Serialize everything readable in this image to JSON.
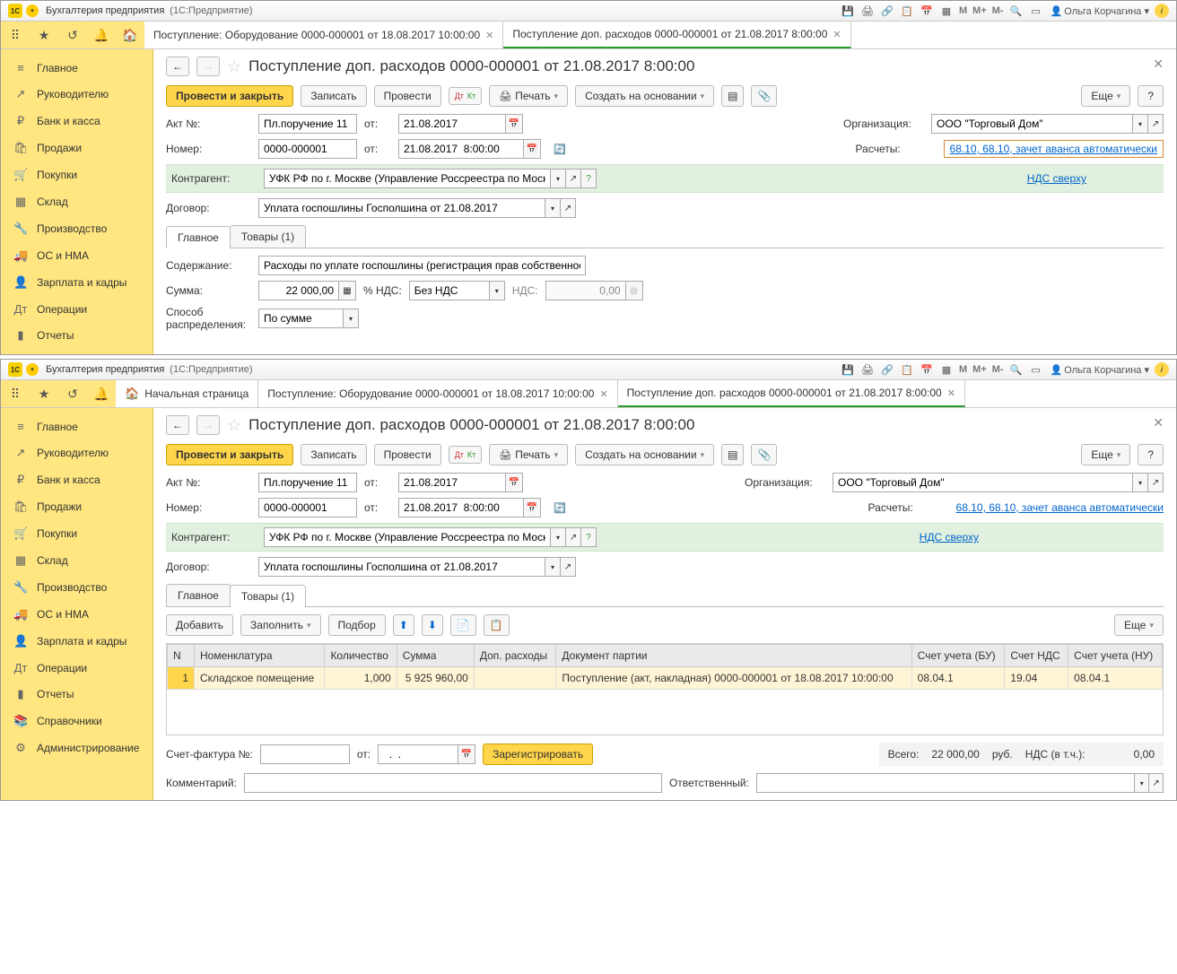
{
  "app": {
    "title": "Бухгалтерия предприятия",
    "subtitle": "(1С:Предприятие)",
    "user": "Ольга Корчагина",
    "marks": {
      "m": "M",
      "mp": "M+",
      "mm": "M-"
    }
  },
  "sidebar": {
    "items": [
      {
        "icon": "≡",
        "label": "Главное"
      },
      {
        "icon": "↗",
        "label": "Руководителю"
      },
      {
        "icon": "₽",
        "label": "Банк и касса"
      },
      {
        "icon": "🛍",
        "label": "Продажи"
      },
      {
        "icon": "🛒",
        "label": "Покупки"
      },
      {
        "icon": "▦",
        "label": "Склад"
      },
      {
        "icon": "🔧",
        "label": "Производство"
      },
      {
        "icon": "🚚",
        "label": "ОС и НМА"
      },
      {
        "icon": "👤",
        "label": "Зарплата и кадры"
      },
      {
        "icon": "Дт",
        "label": "Операции"
      },
      {
        "icon": "▮",
        "label": "Отчеты"
      },
      {
        "icon": "📚",
        "label": "Справочники"
      },
      {
        "icon": "⚙",
        "label": "Администрирование"
      }
    ]
  },
  "tabs": {
    "home_page": "Начальная страница",
    "t1": "Поступление: Оборудование 0000-000001 от 18.08.2017 10:00:00",
    "t2": "Поступление доп. расходов 0000-000001 от 21.08.2017 8:00:00"
  },
  "page": {
    "title": "Поступление доп. расходов 0000-000001 от 21.08.2017 8:00:00"
  },
  "toolbar": {
    "post_close": "Провести и закрыть",
    "save": "Записать",
    "post": "Провести",
    "print": "Печать",
    "create_based": "Создать на основании",
    "more": "Еще",
    "help": "?"
  },
  "form": {
    "act_no_label": "Акт №:",
    "act_no_value": "Пл.поручение 11",
    "from_label": "от:",
    "act_date": "21.08.2017",
    "number_label": "Номер:",
    "number_value": "0000-000001",
    "number_date": "21.08.2017  8:00:00",
    "org_label": "Организация:",
    "org_value": "ООО \"Торговый Дом\"",
    "settlements_label": "Расчеты:",
    "settlements_value": "68.10, 68.10, зачет аванса автоматически",
    "counterparty_label": "Контрагент:",
    "counterparty_value": "УФК РФ по г. Москве (Управление Россреестра по Москв",
    "vat_mode": "НДС сверху",
    "contract_label": "Договор:",
    "contract_value": "Уплата госпошлины Госполшина от 21.08.2017",
    "tab_main": "Главное",
    "tab_goods": "Товары (1)",
    "content_label": "Содержание:",
    "content_value": "Расходы по уплате госпошлины (регистрация прав собственнос",
    "sum_label": "Сумма:",
    "sum_value": "22 000,00",
    "vat_pct_label": "% НДС:",
    "vat_pct_value": "Без НДС",
    "nds_label": "НДС:",
    "nds_value": "0,00",
    "distrib_label": "Способ распределения:",
    "distrib_value": "По сумме"
  },
  "goods_toolbar": {
    "add": "Добавить",
    "fill": "Заполнить",
    "pick": "Подбор",
    "more": "Еще"
  },
  "goods_table": {
    "headers": {
      "n": "N",
      "item": "Номенклатура",
      "qty": "Количество",
      "sum": "Сумма",
      "extra": "Доп. расходы",
      "batch": "Документ партии",
      "acct_bu": "Счет учета (БУ)",
      "acct_nds": "Счет НДС",
      "acct_nu": "Счет учета (НУ)"
    },
    "row": {
      "n": "1",
      "item": "Складское помещение",
      "qty": "1,000",
      "sum": "5 925 960,00",
      "extra": "",
      "batch": "Поступление (акт, накладная) 0000-000001 от 18.08.2017 10:00:00",
      "acct_bu": "08.04.1",
      "acct_nds": "19.04",
      "acct_nu": "08.04.1"
    }
  },
  "footer": {
    "invoice_label": "Счет-фактура №:",
    "invoice_date": "  .  .    ",
    "register": "Зарегистрировать",
    "total_label": "Всего:",
    "total_value": "22 000,00",
    "rub": "руб.",
    "nds_label": "НДС (в т.ч.):",
    "nds_value": "0,00",
    "comment_label": "Комментарий:",
    "responsible_label": "Ответственный:"
  }
}
